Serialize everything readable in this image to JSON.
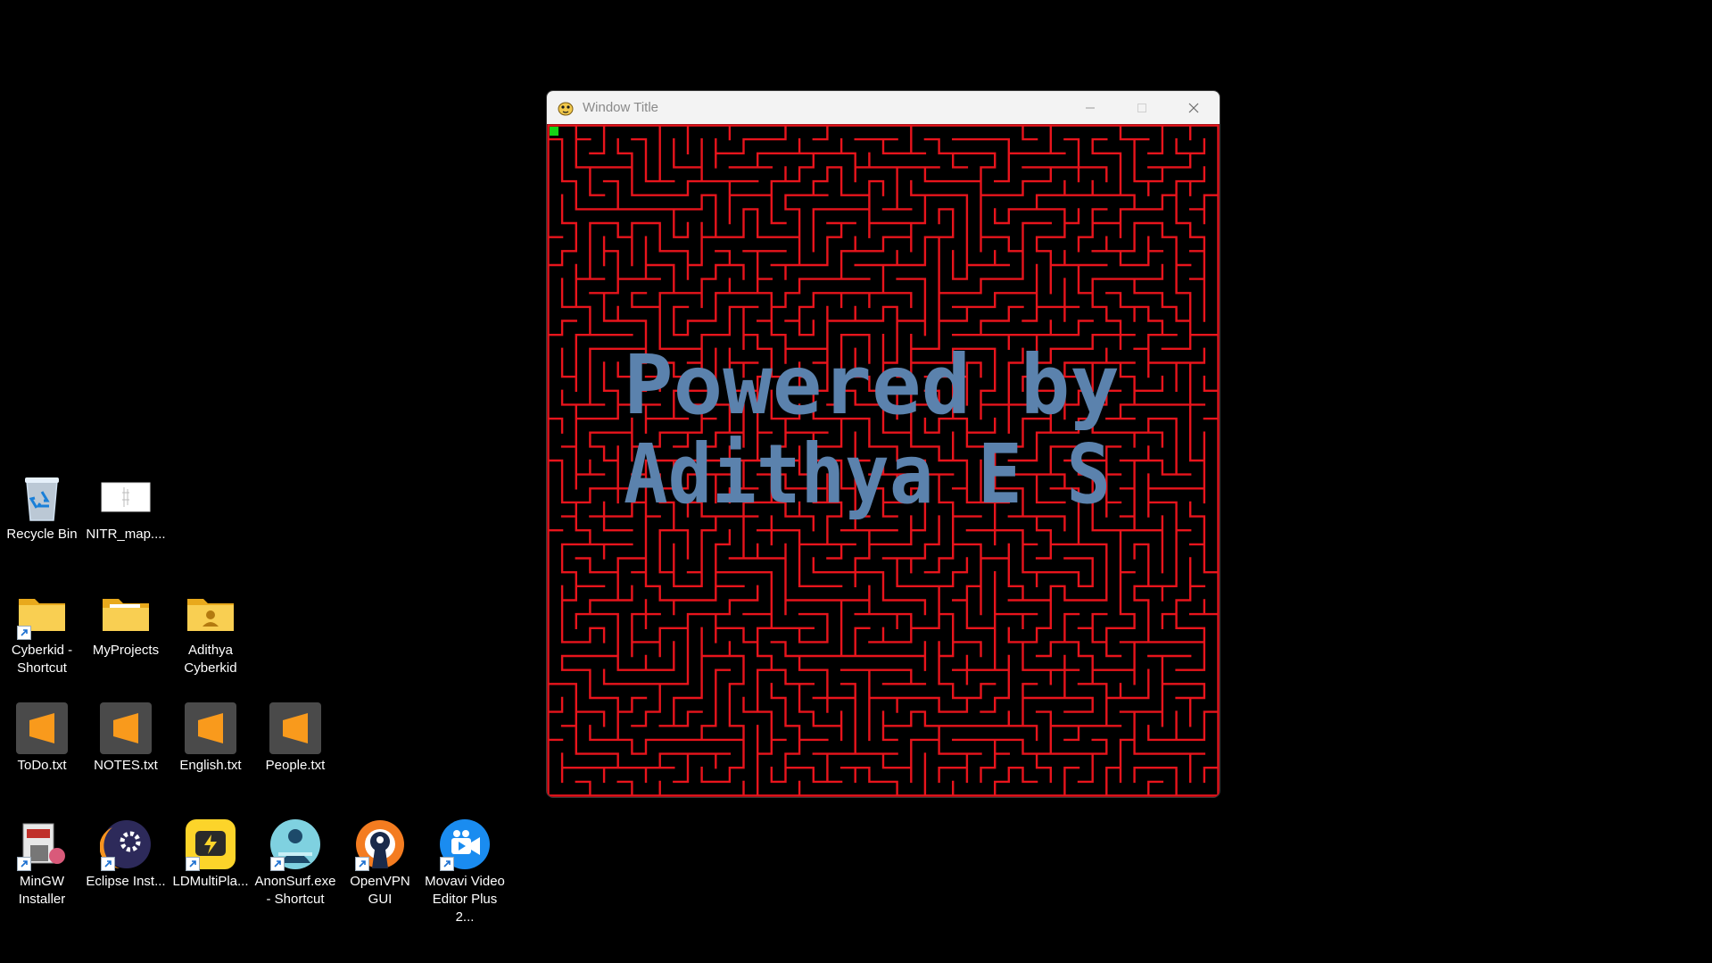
{
  "desktop": {
    "icons": [
      {
        "label": "Recycle Bin",
        "icon": "recycle-bin-icon"
      },
      {
        "label": "NITR_map....",
        "icon": "image-file-icon"
      },
      {
        "label": "Cyberkid - Shortcut",
        "icon": "folder-shortcut-icon"
      },
      {
        "label": "MyProjects",
        "icon": "folder-icon"
      },
      {
        "label": "Adithya Cyberkid",
        "icon": "user-folder-icon"
      },
      {
        "label": "ToDo.txt",
        "icon": "sublime-text-icon"
      },
      {
        "label": "NOTES.txt",
        "icon": "sublime-text-icon"
      },
      {
        "label": "English.txt",
        "icon": "sublime-text-icon"
      },
      {
        "label": "People.txt",
        "icon": "sublime-text-icon"
      },
      {
        "label": "MinGW Installer",
        "icon": "mingw-installer-icon"
      },
      {
        "label": "Eclipse Inst...",
        "icon": "eclipse-installer-icon"
      },
      {
        "label": "LDMultiPla...",
        "icon": "ldmultiplayer-icon"
      },
      {
        "label": "AnonSurf.exe - Shortcut",
        "icon": "anonsurf-icon"
      },
      {
        "label": "OpenVPN GUI",
        "icon": "openvpn-icon"
      },
      {
        "label": "Movavi Video Editor Plus 2...",
        "icon": "movavi-icon"
      }
    ]
  },
  "window": {
    "title": "Window Title",
    "icon": "pygame-snake-icon",
    "controls": [
      "minimize",
      "maximize",
      "close"
    ]
  },
  "game": {
    "overlay_line1": "Powered by",
    "overlay_line2": "Adithya E S",
    "colors": {
      "background": "#000000",
      "maze_walls": "#e8141c",
      "text": "#5b82ad",
      "player_marker": "#16d316"
    },
    "maze_grid": "48x48",
    "player_cell": "top-left"
  }
}
